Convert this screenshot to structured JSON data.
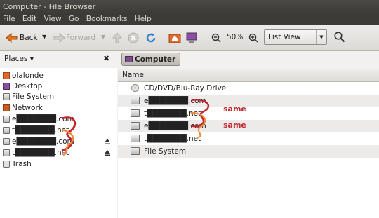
{
  "window": {
    "title": "Computer - File Browser"
  },
  "menu": [
    "File",
    "Edit",
    "View",
    "Go",
    "Bookmarks",
    "Help"
  ],
  "toolbar": {
    "back": "Back",
    "forward": "Forward",
    "zoom_level": "50%",
    "view_mode": "List View"
  },
  "sidebar": {
    "header": "Places ▾",
    "close": "✖",
    "items": [
      {
        "label": "olalonde",
        "icon": "home-folder-icon"
      },
      {
        "label": "Desktop",
        "icon": "desktop-icon"
      },
      {
        "label": "File System",
        "icon": "drive-icon"
      },
      {
        "label": "Network",
        "icon": "network-icon"
      },
      {
        "label": "e███████.com",
        "icon": "drive-icon"
      },
      {
        "label": "t███████.net",
        "icon": "drive-icon"
      },
      {
        "label": "e███████.com",
        "icon": "drive-icon"
      },
      {
        "label": "t███████.net",
        "icon": "drive-icon"
      },
      {
        "label": "Trash",
        "icon": "trash-icon"
      }
    ]
  },
  "path": {
    "current": "Computer"
  },
  "list": {
    "column_name": "Name",
    "rows": [
      {
        "name": "CD/DVD/Blu-Ray Drive",
        "icon": "optical-drive-icon"
      },
      {
        "name": "e███████.com",
        "icon": "drive-icon"
      },
      {
        "name": "t███████.net",
        "icon": "drive-icon"
      },
      {
        "name": "e███████.com",
        "icon": "drive-icon"
      },
      {
        "name": "t███████.net",
        "icon": "drive-icon"
      },
      {
        "name": "File System",
        "icon": "drive-icon"
      }
    ]
  },
  "annotations": [
    "same",
    "same"
  ],
  "colors": {
    "annotation_red": "#c1272d",
    "annotation_orange": "#f08a3c"
  }
}
